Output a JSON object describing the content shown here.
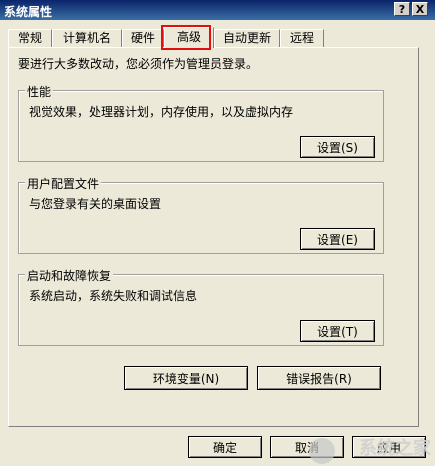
{
  "window": {
    "title": "系统属性",
    "help_label": "?",
    "close_label": "X"
  },
  "tabs": [
    {
      "label": "常规"
    },
    {
      "label": "计算机名"
    },
    {
      "label": "硬件"
    },
    {
      "label": "高级",
      "active": true
    },
    {
      "label": "自动更新"
    },
    {
      "label": "远程"
    }
  ],
  "advanced": {
    "note": "要进行大多数改动，您必须作为管理员登录。",
    "performance": {
      "title": "性能",
      "description": "视觉效果，处理器计划，内存使用，以及虚拟内存",
      "button": "设置(S)"
    },
    "user_profiles": {
      "title": "用户配置文件",
      "description": "与您登录有关的桌面设置",
      "button": "设置(E)"
    },
    "startup_recovery": {
      "title": "启动和故障恢复",
      "description": "系统启动，系统失败和调试信息",
      "button": "设置(T)"
    },
    "env_button": "环境变量(N)",
    "error_button": "错误报告(R)"
  },
  "footer": {
    "ok": "确定",
    "cancel": "取消",
    "apply": "应用"
  },
  "watermark": {
    "text": "系统之家"
  }
}
